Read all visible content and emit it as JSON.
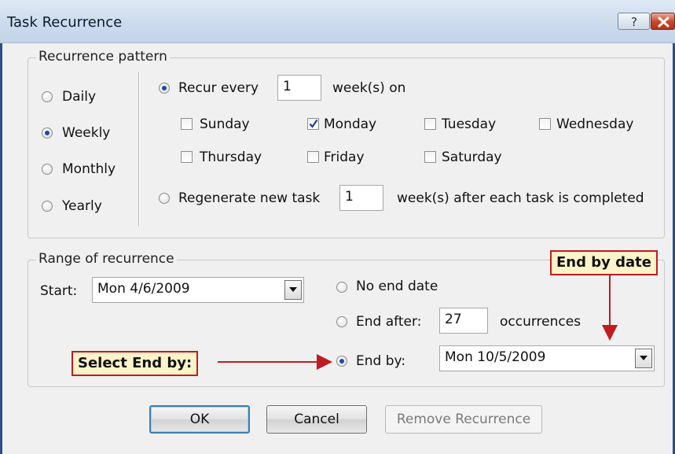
{
  "window": {
    "title": "Task Recurrence",
    "help_label": "?"
  },
  "pattern": {
    "legend": "Recurrence pattern",
    "frequencies": [
      {
        "label": "Daily",
        "selected": false
      },
      {
        "label": "Weekly",
        "selected": true
      },
      {
        "label": "Monthly",
        "selected": false
      },
      {
        "label": "Yearly",
        "selected": false
      }
    ],
    "recur_every_label": "Recur every",
    "recur_every_value": "1",
    "recur_suffix": "week(s) on",
    "days": [
      {
        "label": "Sunday",
        "checked": false
      },
      {
        "label": "Monday",
        "checked": true
      },
      {
        "label": "Tuesday",
        "checked": false
      },
      {
        "label": "Wednesday",
        "checked": false
      },
      {
        "label": "Thursday",
        "checked": false
      },
      {
        "label": "Friday",
        "checked": false
      },
      {
        "label": "Saturday",
        "checked": false
      }
    ],
    "regenerate_label": "Regenerate new task",
    "regenerate_value": "1",
    "regenerate_suffix": "week(s) after each task is completed"
  },
  "range": {
    "legend": "Range of recurrence",
    "start_label": "Start:",
    "start_value": "Mon 4/6/2009",
    "no_end_label": "No end date",
    "end_after_label": "End after:",
    "end_after_value": "27",
    "occurrences_label": "occurrences",
    "end_by_label": "End by:",
    "end_by_value": "Mon 10/5/2009",
    "selected_option": "end_by"
  },
  "buttons": {
    "ok": "OK",
    "cancel": "Cancel",
    "remove": "Remove Recurrence"
  },
  "callouts": {
    "end_by_date": "End by date",
    "select_end_by": "Select End by:"
  },
  "colors": {
    "callout_border": "#c11b22",
    "callout_fill": "#fdf3c8",
    "radio_dot": "#1a4aa8"
  }
}
